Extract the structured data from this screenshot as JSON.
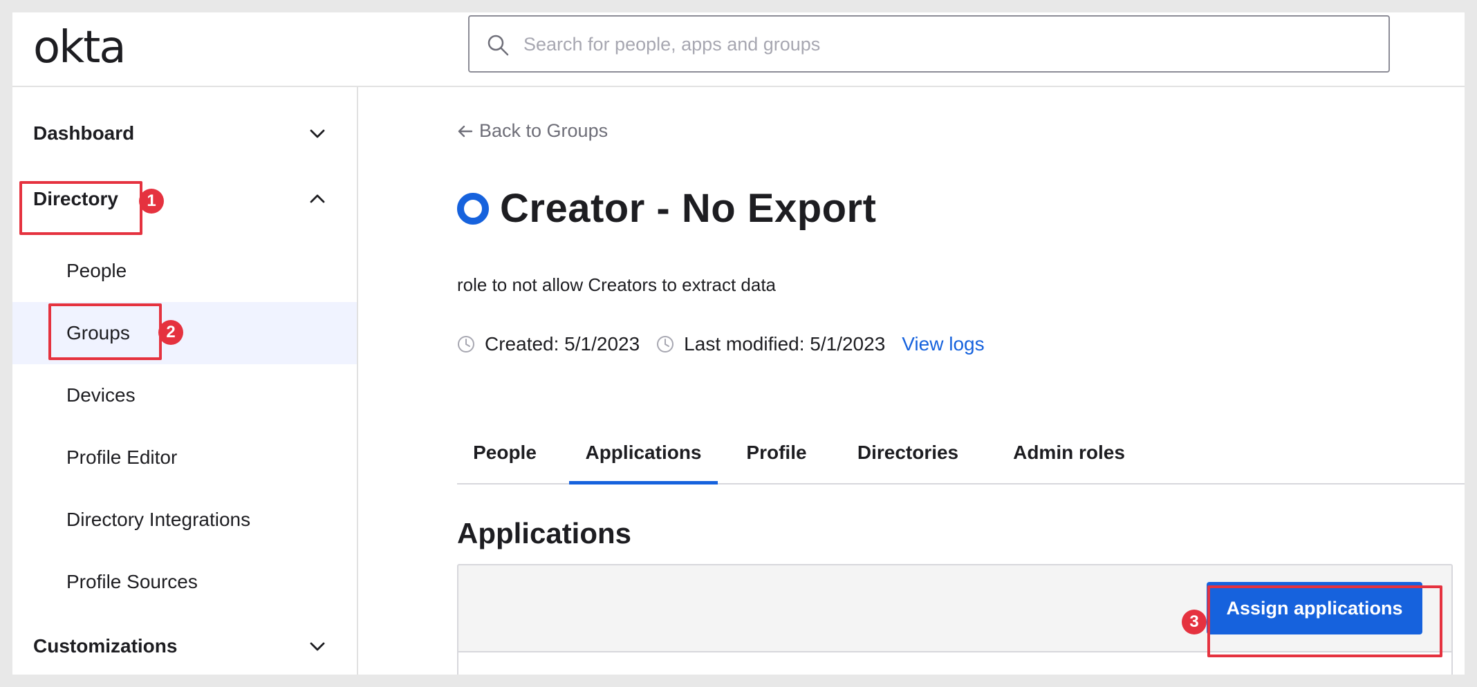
{
  "header": {
    "logo_text": "okta",
    "search_placeholder": "Search for people, apps and groups",
    "search_icon": "search-icon"
  },
  "sidebar": {
    "sections": [
      {
        "label": "Dashboard",
        "expanded": false
      },
      {
        "label": "Directory",
        "expanded": true
      },
      {
        "label": "Customizations",
        "expanded": false
      }
    ],
    "directory_items": [
      {
        "label": "People",
        "active": false
      },
      {
        "label": "Groups",
        "active": true
      },
      {
        "label": "Devices",
        "active": false
      },
      {
        "label": "Profile Editor",
        "active": false
      },
      {
        "label": "Directory Integrations",
        "active": false
      },
      {
        "label": "Profile Sources",
        "active": false
      }
    ]
  },
  "annotations": {
    "step1": "1",
    "step2": "2",
    "step3": "3",
    "color": "#e5323f"
  },
  "main": {
    "back_link": "Back to Groups",
    "group_title": "Creator - No Export",
    "description": "role to not allow Creators to extract data",
    "created": "Created: 5/1/2023",
    "last_modified": "Last modified: 5/1/2023",
    "view_logs": "View logs",
    "tabs": [
      {
        "label": "People",
        "active": false
      },
      {
        "label": "Applications",
        "active": true
      },
      {
        "label": "Profile",
        "active": false
      },
      {
        "label": "Directories",
        "active": false
      },
      {
        "label": "Admin roles",
        "active": false
      }
    ],
    "section_title": "Applications",
    "assign_button": "Assign applications"
  },
  "colors": {
    "accent": "#1662dd",
    "active_bg": "#f0f3ff"
  }
}
